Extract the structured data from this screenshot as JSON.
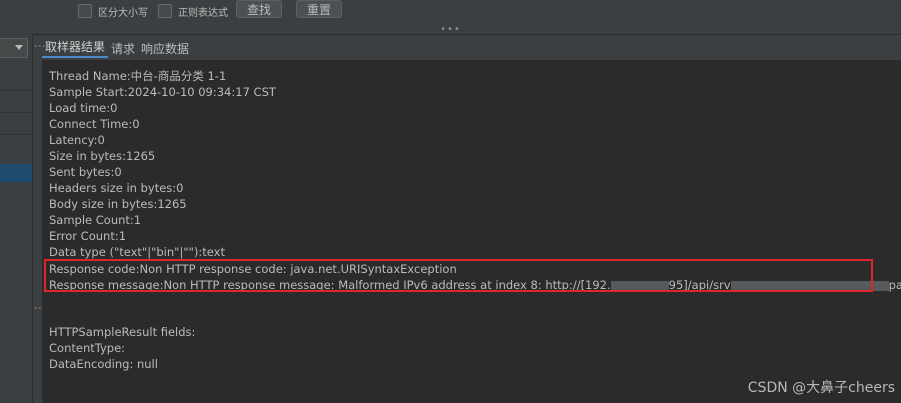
{
  "search": {
    "case_sensitive_label": "区分大小写",
    "regex_label": "正则表达式",
    "find_button": "查找",
    "reset_button": "重置"
  },
  "tabs": [
    {
      "label": "取样器结果",
      "active": true
    },
    {
      "label": "请求",
      "active": false
    },
    {
      "label": "响应数据",
      "active": false
    }
  ],
  "result_lines": [
    "Thread Name:中台-商品分类 1-1",
    "Sample Start:2024-10-10 09:34:17 CST",
    "Load time:0",
    "Connect Time:0",
    "Latency:0",
    "Size in bytes:1265",
    "Sent bytes:0",
    "Headers size in bytes:0",
    "Body size in bytes:1265",
    "Sample Count:1",
    "Error Count:1",
    "Data type (\"text\"|\"bin\"|\"\"):text"
  ],
  "response_code_line": "Response code:Non HTTP response code: java.net.URISyntaxException",
  "response_message": {
    "part1": "Response message:Non HTTP response message: Malformed IPv6 address at index 8: http://[192.",
    "part2": "95]/api/srv",
    "part3": "page"
  },
  "fields_lines": [
    "HTTPSampleResult fields:",
    "ContentType:",
    "DataEncoding: null"
  ],
  "watermark": "CSDN @大鼻子cheers",
  "colors": {
    "highlight_border": "#e0262a",
    "active_tab_underline": "#4a88c7",
    "background": "#2b2b2b"
  }
}
